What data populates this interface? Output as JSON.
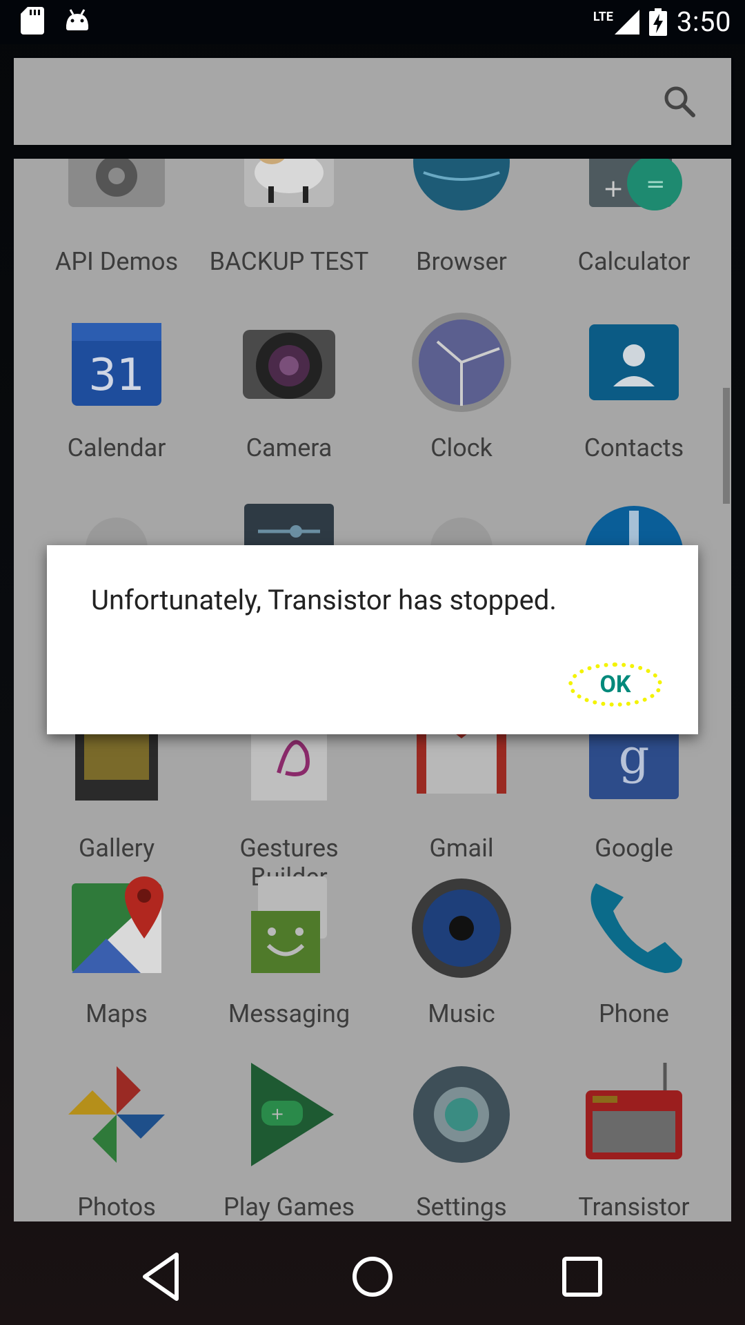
{
  "status_bar": {
    "time": "3:50",
    "network_label": "LTE",
    "icons": [
      "sd-card-icon",
      "android-icon",
      "signal-icon",
      "battery-charging-icon"
    ]
  },
  "search": {
    "icon": "search-icon"
  },
  "apps": [
    {
      "label": "API Demos",
      "icon": "api-demos-icon"
    },
    {
      "label": "BACKUP TEST",
      "icon": "backup-test-icon"
    },
    {
      "label": "Browser",
      "icon": "browser-icon"
    },
    {
      "label": "Calculator",
      "icon": "calculator-icon"
    },
    {
      "label": "Calendar",
      "icon": "calendar-icon",
      "badge": "31"
    },
    {
      "label": "Camera",
      "icon": "camera-icon"
    },
    {
      "label": "Clock",
      "icon": "clock-icon"
    },
    {
      "label": "Contacts",
      "icon": "contacts-icon"
    },
    {
      "label": "Gallery",
      "icon": "gallery-icon"
    },
    {
      "label": "Gestures Builder",
      "icon": "gestures-builder-icon"
    },
    {
      "label": "Gmail",
      "icon": "gmail-icon"
    },
    {
      "label": "Google",
      "icon": "google-icon"
    },
    {
      "label": "Maps",
      "icon": "maps-icon"
    },
    {
      "label": "Messaging",
      "icon": "messaging-icon"
    },
    {
      "label": "Music",
      "icon": "music-icon"
    },
    {
      "label": "Phone",
      "icon": "phone-icon"
    },
    {
      "label": "Photos",
      "icon": "photos-icon"
    },
    {
      "label": "Play Games",
      "icon": "play-games-icon"
    },
    {
      "label": "Settings",
      "icon": "settings-icon"
    },
    {
      "label": "Transistor",
      "icon": "transistor-icon"
    }
  ],
  "dialog": {
    "message": "Unfortunately, Transistor has stopped.",
    "ok_label": "OK"
  },
  "navigation": {
    "back": "back-icon",
    "home": "home-icon",
    "recents": "recents-icon"
  },
  "colors": {
    "accent": "#00897b",
    "highlight": "#f3f300"
  }
}
